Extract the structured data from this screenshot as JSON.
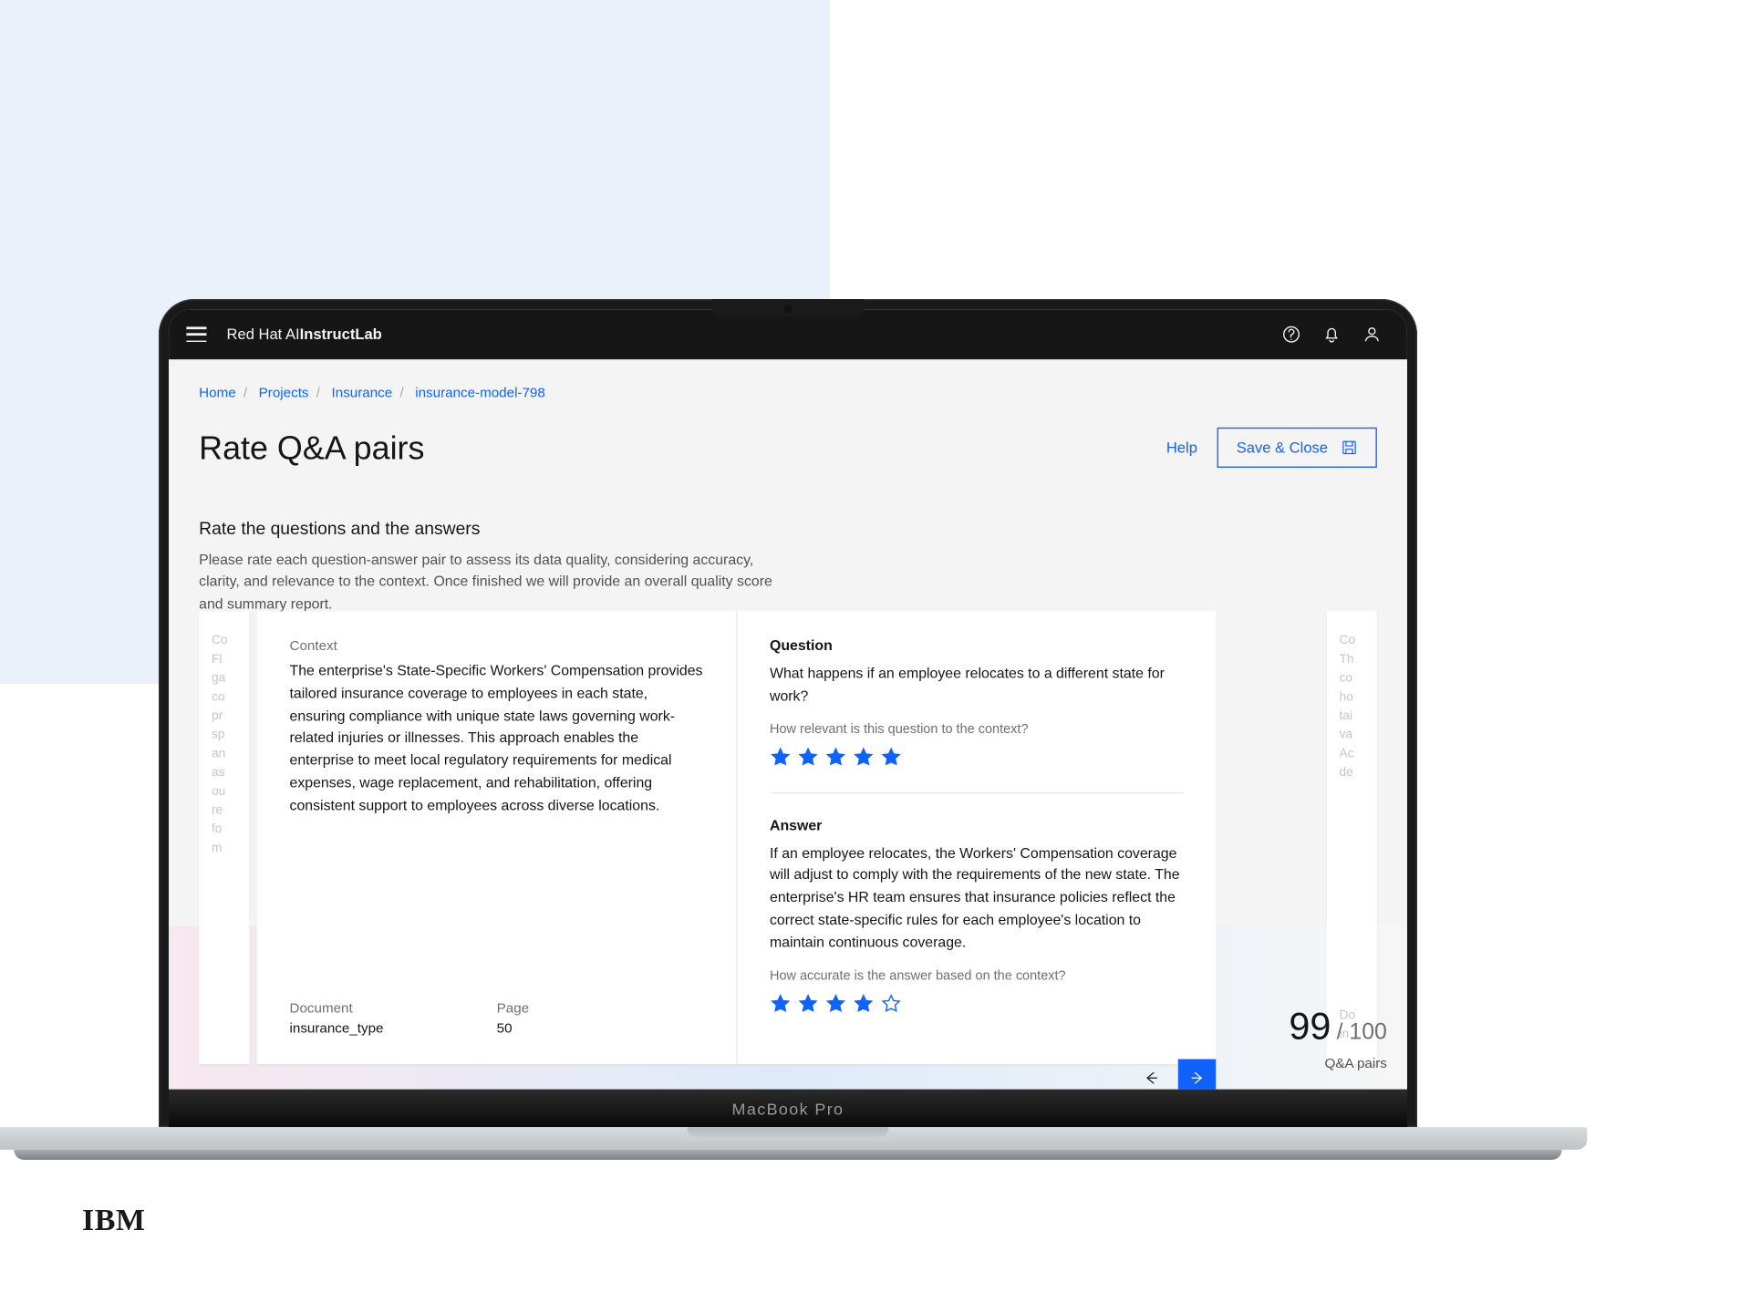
{
  "header": {
    "brand_prefix": "Red Hat AI ",
    "brand_product": "InstructLab"
  },
  "breadcrumb": {
    "items": [
      "Home",
      "Projects",
      "Insurance",
      "insurance-model-798"
    ]
  },
  "page": {
    "title": "Rate Q&A pairs",
    "help_label": "Help",
    "save_label": "Save & Close",
    "subhead": "Rate the questions and the answers",
    "description": "Please rate each question-answer pair to assess its data quality, considering accuracy, clarity, and relevance to the context. Once finished we will provide an overall quality score and summary report."
  },
  "card": {
    "context_label": "Context",
    "context_text": "The enterprise's State-Specific Workers' Compensation provides tailored insurance coverage to employees in each state, ensuring compliance with unique state laws governing work-related injuries or illnesses. This approach enables the enterprise to meet local regulatory requirements for medical expenses, wage replacement, and rehabilitation, offering consistent support to employees across diverse locations.",
    "document_label": "Document",
    "document_value": "insurance_type",
    "page_label": "Page",
    "page_value": "50",
    "question_label": "Question",
    "question_text": "What happens if an employee relocates to a different state for work?",
    "question_hint": "How relevant is this question to the context?",
    "question_rating": 5,
    "answer_label": "Answer",
    "answer_text": "If an employee relocates, the Workers' Compensation coverage will adjust to comply with the requirements of the new state. The enterprise's HR team ensures that insurance policies reflect the correct state-specific rules for each employee's location to maintain continuous coverage.",
    "answer_hint": "How accurate is the answer based on the context?",
    "answer_rating": 4
  },
  "counter": {
    "current": "99",
    "total": "100",
    "caption": "Q&A pairs"
  },
  "ghost": {
    "left": "Co\nFl\nga\nco\npr\nsp\nan\nas\nou\nre\nfo\nm",
    "right": "Co\nTh\nco\nho\ntai\nva\nAc\nde",
    "right_meta": "Do\nin"
  },
  "logo": "IBM",
  "device": "MacBook Pro"
}
